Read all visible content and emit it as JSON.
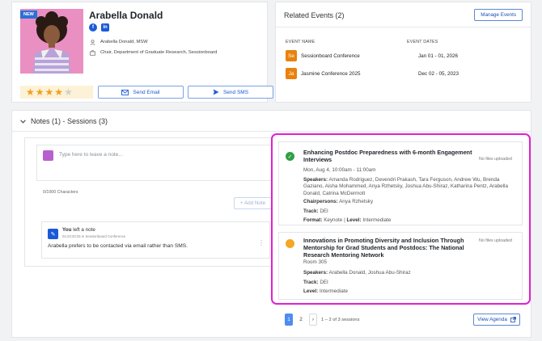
{
  "profile": {
    "badge": "NEW",
    "name": "Arabella Donald",
    "socials": [
      "facebook-icon",
      "linkedin-icon"
    ],
    "credential": "Arabella Donald, MSW",
    "role": "Chair, Department of Graduate Research, Sessionboard",
    "rating": 4,
    "rating_max": 5,
    "send_email": "Send Email",
    "send_sms": "Send SMS"
  },
  "related": {
    "title": "Related Events (2)",
    "manage": "Manage Events",
    "col_name": "EVENT NAME",
    "col_dates": "EVENT DATES",
    "events": [
      {
        "initials": "Se",
        "name": "Sessionboard Conference",
        "dates": "Jan 01 - 01, 2026"
      },
      {
        "initials": "Ja",
        "name": "Jasmine Conference 2025",
        "dates": "Dec 02 - 05, 2023"
      }
    ]
  },
  "notes": {
    "header": "Notes (1) - Sessions (3)",
    "placeholder": "Type here to leave a note...",
    "char_count": "0/1000 Characters",
    "add_note": "+ Add Note",
    "entry": {
      "author": "You",
      "action": "left a note",
      "time": "04:23:20:25",
      "in_word": "in",
      "event": "Sessionboard Conference",
      "text": "Arabella prefers to be contacted via email rather than SMS."
    }
  },
  "sessions": {
    "items": [
      {
        "status": "green",
        "title_1": "Enhancing Postdoc Preparedness with 6-month Engagement",
        "title_2": "Interviews",
        "time": "Mon, Aug 4, 10:00am - 11:00am",
        "speakers_label": "Speakers:",
        "speakers_1": "Amanda Rodriguez, Devendri Prakash, Tara Ferguson, Andrew Wu, Brenda",
        "speakers_2": "Gaziano, Aisha Mohammed, Anya Rzhetsky, Joshua Abu-Shiraz, Katharina Pentz, Arabella",
        "speakers_3": "Donald, Catrina McDermott",
        "chair_label": "Chairpersons:",
        "chairs": "Anya Rzhetsky",
        "track_label": "Track:",
        "track": "DEI",
        "format_label": "Format:",
        "format": "Keynote",
        "sep": "|",
        "level_label": "Level:",
        "level": "Intermediate",
        "files": "No files uploaded"
      },
      {
        "status": "orange",
        "title_1": "Innovations in Promoting Diversity and Inclusion Through",
        "title_2": "Mentorship for Grad Students and Postdocs: The National",
        "title_3": "Research Mentoring Network",
        "room": "Room 305",
        "speakers_label": "Speakers:",
        "speakers": "Arabella Donald, Joshua Abu-Shiraz",
        "track_label": "Track:",
        "track": "DEI",
        "level_label": "Level:",
        "level": "Intermediate",
        "files": "No files uploaded"
      }
    ],
    "pager": {
      "page1": "1",
      "page2": "2",
      "next": "›",
      "summary": "1 – 2 of 3 sessions"
    },
    "view_agenda": "View Agenda"
  },
  "colors": {
    "accent": "#1a5ad6",
    "highlight": "#e020d0",
    "event_avatar": "#e8820c",
    "status_green": "#2ea043",
    "status_orange": "#f5a623"
  }
}
